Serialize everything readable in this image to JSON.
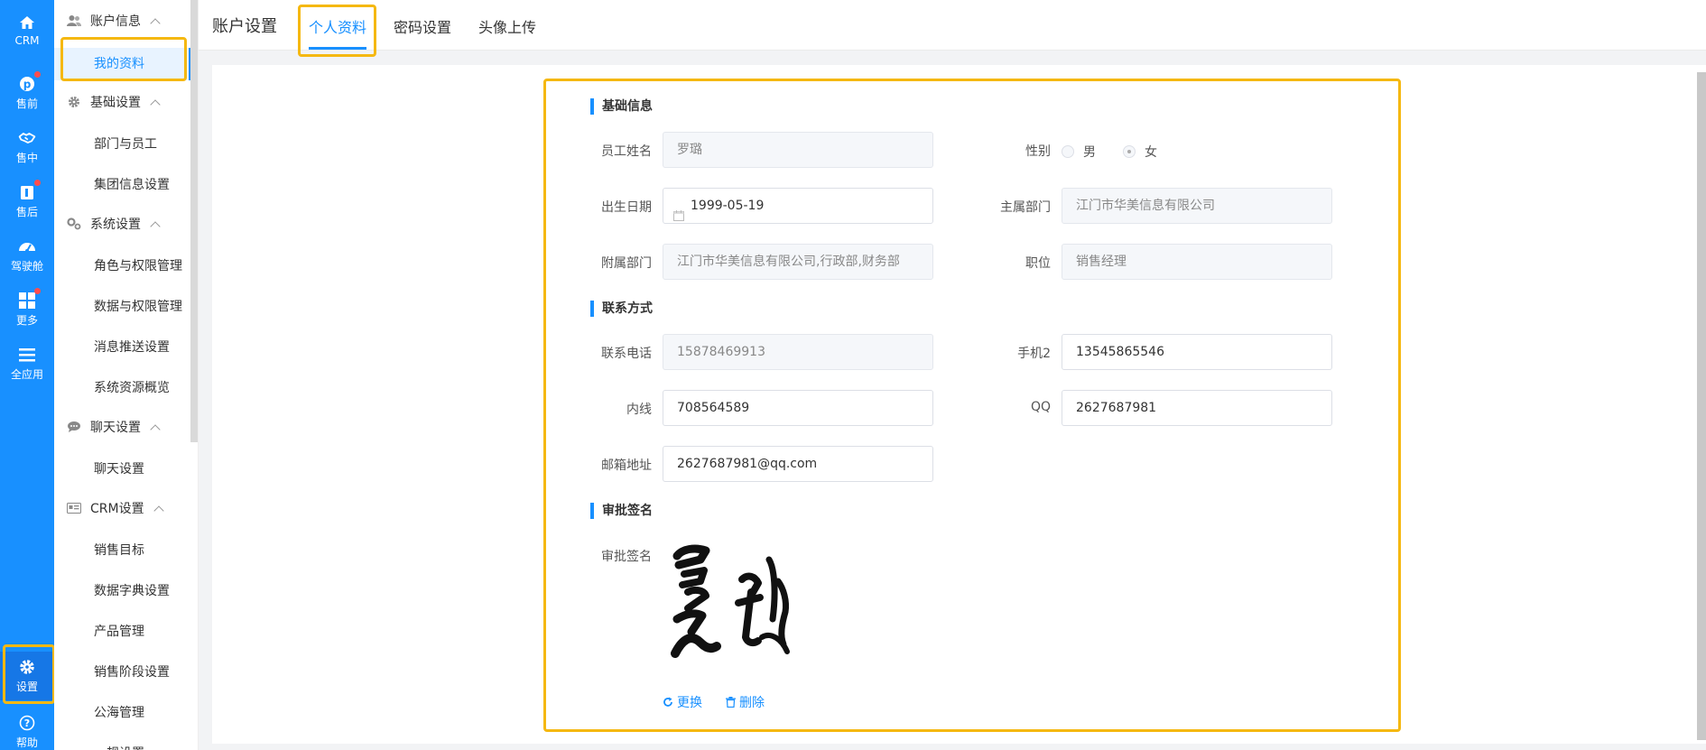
{
  "rail": {
    "items": [
      {
        "label": "CRM",
        "icon": "home-icon"
      },
      {
        "label": "售前",
        "icon": "pinterest-icon"
      },
      {
        "label": "售中",
        "icon": "handshake-icon"
      },
      {
        "label": "售后",
        "icon": "clipboard-icon"
      },
      {
        "label": "驾驶舱",
        "icon": "dashboard-icon"
      },
      {
        "label": "更多",
        "icon": "grid-icon"
      },
      {
        "label": "全应用",
        "icon": "menu-icon"
      },
      {
        "label": "设置",
        "icon": "gear-icon"
      },
      {
        "label": "帮助",
        "icon": "help-icon"
      }
    ]
  },
  "submenu": {
    "groups": [
      {
        "title": "账户信息",
        "items": [
          "我的资料"
        ]
      },
      {
        "title": "基础设置",
        "items": [
          "部门与员工",
          "集团信息设置"
        ]
      },
      {
        "title": "系统设置",
        "items": [
          "角色与权限管理",
          "数据与权限管理",
          "消息推送设置",
          "系统资源概览"
        ]
      },
      {
        "title": "聊天设置",
        "items": [
          "聊天设置"
        ]
      },
      {
        "title": "CRM设置",
        "items": [
          "销售目标",
          "数据字典设置",
          "产品管理",
          "销售阶段设置",
          "公海管理",
          "…规设置"
        ]
      }
    ]
  },
  "header": {
    "title": "账户设置",
    "tabs": [
      "个人资料",
      "密码设置",
      "头像上传"
    ]
  },
  "form": {
    "sections": {
      "basic": "基础信息",
      "contact": "联系方式",
      "signature": "审批签名"
    },
    "labels": {
      "name": "员工姓名",
      "gender": "性别",
      "birthday": "出生日期",
      "main_dept": "主属部门",
      "sub_dept": "附属部门",
      "position": "职位",
      "phone": "联系电话",
      "mobile2": "手机2",
      "ext": "内线",
      "qq": "QQ",
      "email": "邮箱地址",
      "signature": "审批签名"
    },
    "values": {
      "name": "罗璐",
      "gender_male": "男",
      "gender_female": "女",
      "birthday": "1999-05-19",
      "main_dept": "江门市华美信息有限公司",
      "sub_dept": "江门市华美信息有限公司,行政部,财务部",
      "position": "销售经理",
      "phone": "15878469913",
      "mobile2": "13545865546",
      "ext": "708564589",
      "qq": "2627687981",
      "email": "2627687981@qq.com",
      "signature_text": "罗璐"
    },
    "actions": {
      "replace": "更换",
      "delete": "删除"
    }
  },
  "colors": {
    "primary": "#1890ff",
    "highlight": "#f5b811"
  }
}
